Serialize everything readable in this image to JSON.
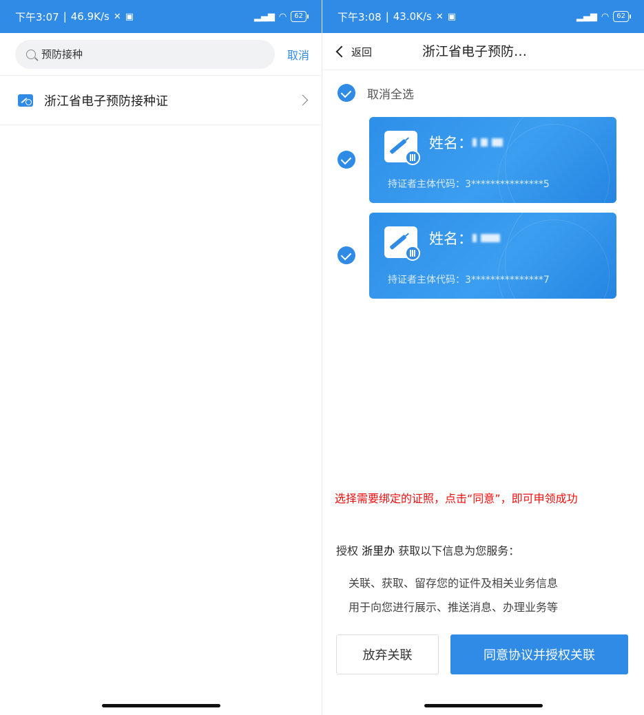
{
  "left": {
    "status": {
      "time": "下午3:07",
      "speed": "46.9K/s",
      "battery": "62"
    },
    "search": {
      "value": "预防接种",
      "cancel_label": "取消"
    },
    "result": {
      "label": "浙江省电子预防接种证"
    }
  },
  "right": {
    "status": {
      "time": "下午3:08",
      "speed": "43.0K/s",
      "battery": "62"
    },
    "nav": {
      "back_label": "返回",
      "title": "浙江省电子预防…"
    },
    "select_all_label": "取消全选",
    "cards": [
      {
        "name_label": "姓名：",
        "code_label": "持证者主体代码：",
        "code_value": "3***************5",
        "checked": true
      },
      {
        "name_label": "姓名：",
        "code_label": "持证者主体代码：",
        "code_value": "3***************7",
        "checked": true
      }
    ],
    "hint": "选择需要绑定的证照，点击“同意”，即可申领成功",
    "auth": {
      "prefix": "授权",
      "app_name": "浙里办",
      "suffix": "获取以下信息为您服务：",
      "lines": [
        "关联、获取、留存您的证件及相关业务信息",
        "用于向您进行展示、推送消息、办理业务等"
      ]
    },
    "buttons": {
      "reject_label": "放弃关联",
      "agree_label": "同意协议并授权关联"
    }
  },
  "colors": {
    "primary": "#2f8be6",
    "hint": "#f20d0d"
  },
  "icons": [
    "search-icon",
    "chevron-right-icon",
    "back-chevron-icon",
    "check-icon",
    "vaccine-icon",
    "signal-icon",
    "wifi-icon",
    "battery-icon"
  ]
}
